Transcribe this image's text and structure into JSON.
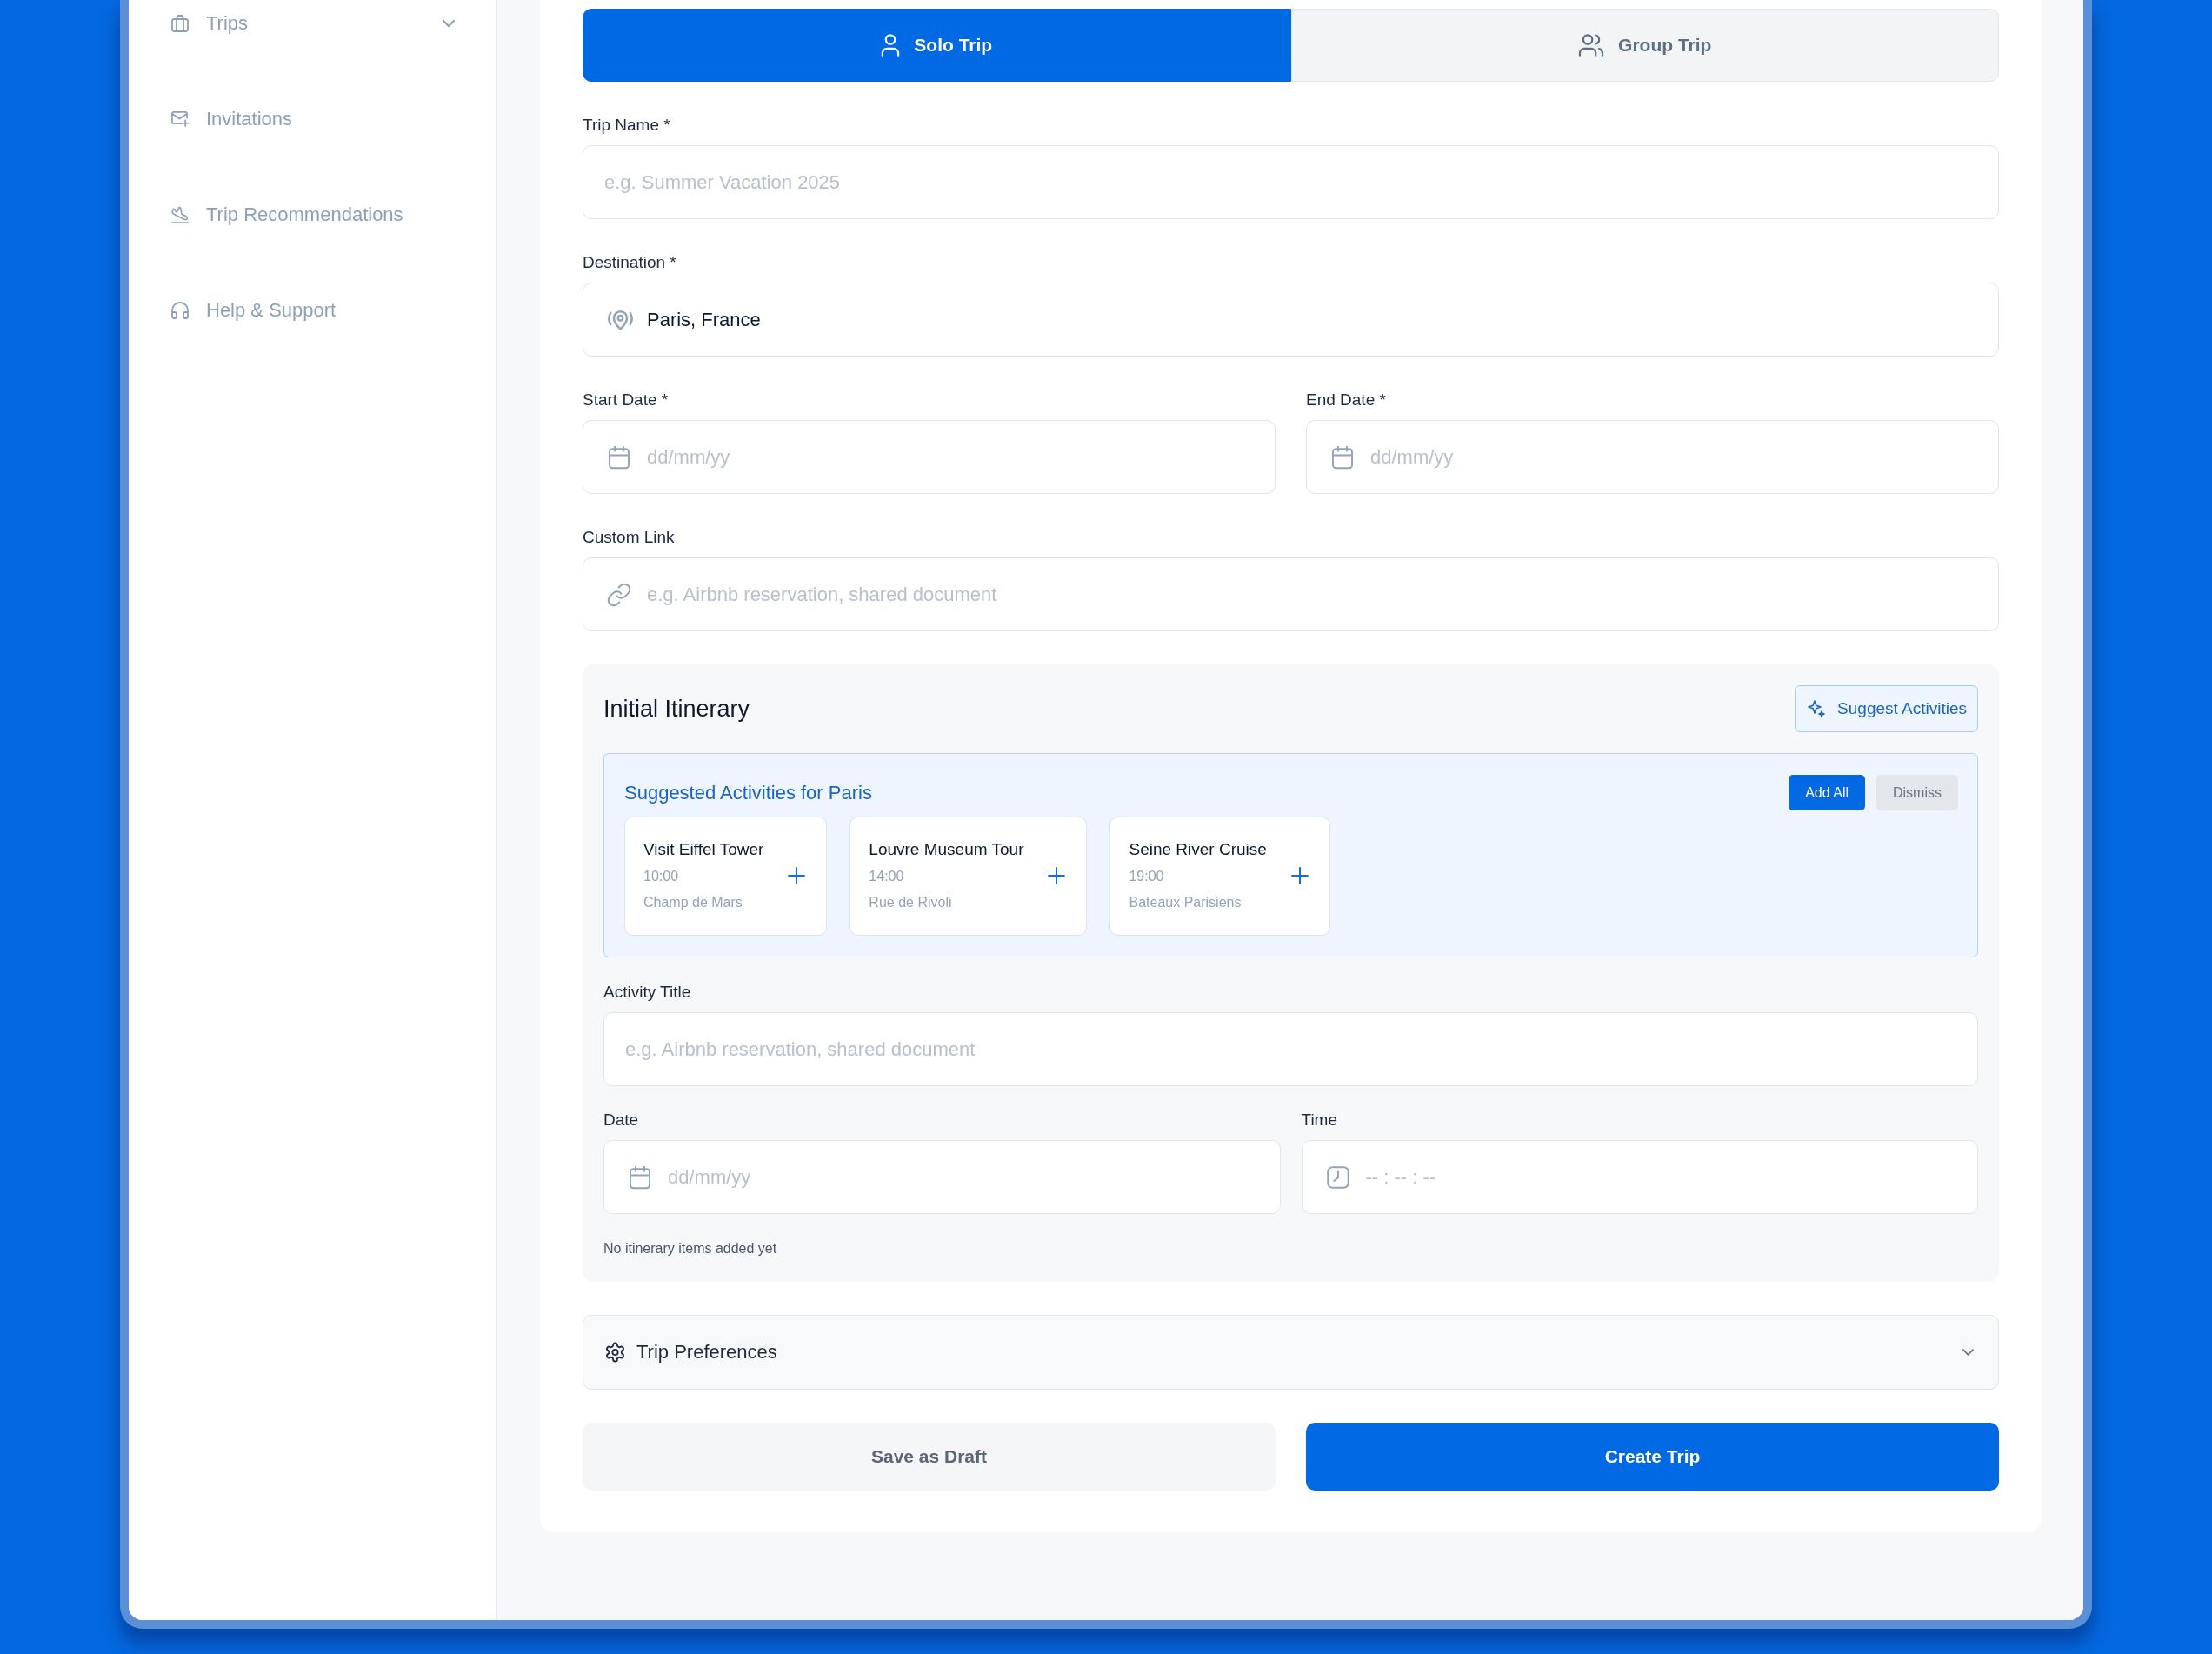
{
  "sidebar": {
    "items": [
      {
        "label": "Trips",
        "kind": "group",
        "expanded": false
      },
      {
        "label": "Invitations",
        "kind": "link"
      },
      {
        "label": "Trip Recommendations",
        "kind": "link"
      },
      {
        "label": "Help & Support",
        "kind": "link"
      }
    ]
  },
  "trip_type_tabs": [
    {
      "label": "Solo Trip",
      "selected": true
    },
    {
      "label": "Group Trip",
      "selected": false
    }
  ],
  "form_rows": [
    {
      "fields": [
        {
          "label": "Trip Name *",
          "kind": "text",
          "placeholder": "e.g. Summer Vacation 2025"
        }
      ]
    },
    {
      "fields": [
        {
          "label": "Destination *",
          "kind": "location",
          "value": "Paris, France"
        }
      ]
    },
    {
      "fields": [
        {
          "label": "Start Date *",
          "kind": "date",
          "placeholder": "dd/mm/yy"
        },
        {
          "label": "End Date *",
          "kind": "date",
          "placeholder": "dd/mm/yy"
        }
      ]
    },
    {
      "fields": [
        {
          "label": "Custom Link",
          "kind": "link",
          "placeholder": "e.g. Airbnb reservation, shared document"
        }
      ]
    }
  ],
  "itinerary": {
    "title": "Initial Itinerary",
    "suggest_button": "Suggest Activities",
    "suggestions": {
      "title": "Suggested Activities for Paris",
      "buttons": [
        {
          "label": "Add All",
          "kind": "primary"
        },
        {
          "label": "Dismiss",
          "kind": "secondary"
        }
      ],
      "activities": [
        {
          "title": "Visit Eiffel Tower",
          "time": "10:00",
          "place": "Champ de Mars"
        },
        {
          "title": "Louvre Museum Tour",
          "time": "14:00",
          "place": "Rue de Rivoli"
        },
        {
          "title": "Seine River Cruise",
          "time": "19:00",
          "place": "Bateaux Parisiens"
        }
      ]
    },
    "form_rows": [
      {
        "fields": [
          {
            "label": "Activity Title",
            "kind": "text",
            "placeholder": "e.g. Airbnb reservation, shared document"
          }
        ]
      },
      {
        "fields": [
          {
            "label": "Date",
            "kind": "date",
            "placeholder": "dd/mm/yy"
          },
          {
            "label": "Time",
            "kind": "time",
            "placeholder": "-- : -- : --"
          }
        ]
      }
    ],
    "empty_note": "No itinerary items added yet"
  },
  "preferences": {
    "label": "Trip Preferences",
    "expanded": false
  },
  "actions": [
    {
      "label": "Save as Draft",
      "kind": "secondary"
    },
    {
      "label": "Create Trip",
      "kind": "primary"
    }
  ]
}
